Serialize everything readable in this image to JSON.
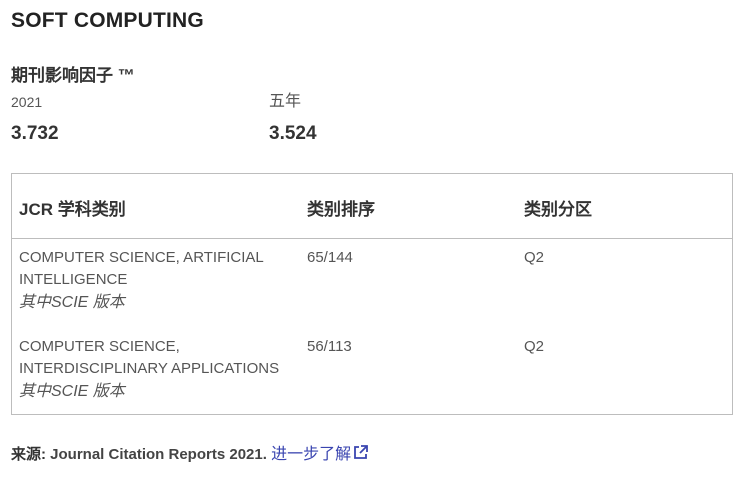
{
  "journal": {
    "title": "SOFT COMPUTING"
  },
  "impact_factor": {
    "heading": "期刊影响因子 ™",
    "metrics": [
      {
        "label": "2021",
        "value": "3.732"
      },
      {
        "label": "五年",
        "value": "3.524"
      }
    ]
  },
  "jcr_table": {
    "headers": [
      "JCR 学科类别",
      "类别排序",
      "类别分区"
    ],
    "rows": [
      {
        "category": "COMPUTER SCIENCE, ARTIFICIAL INTELLIGENCE",
        "edition": "其中SCIE 版本",
        "rank": "65/144",
        "quartile": "Q2"
      },
      {
        "category": "COMPUTER SCIENCE, INTERDISCIPLINARY APPLICATIONS",
        "edition": "其中SCIE 版本",
        "rank": "56/113",
        "quartile": "Q2"
      }
    ]
  },
  "source": {
    "label": "来源:",
    "text": "Journal Citation Reports  2021.",
    "link_label": "进一步了解",
    "link_icon": "external-link-icon",
    "link_color": "#3a45b0"
  }
}
